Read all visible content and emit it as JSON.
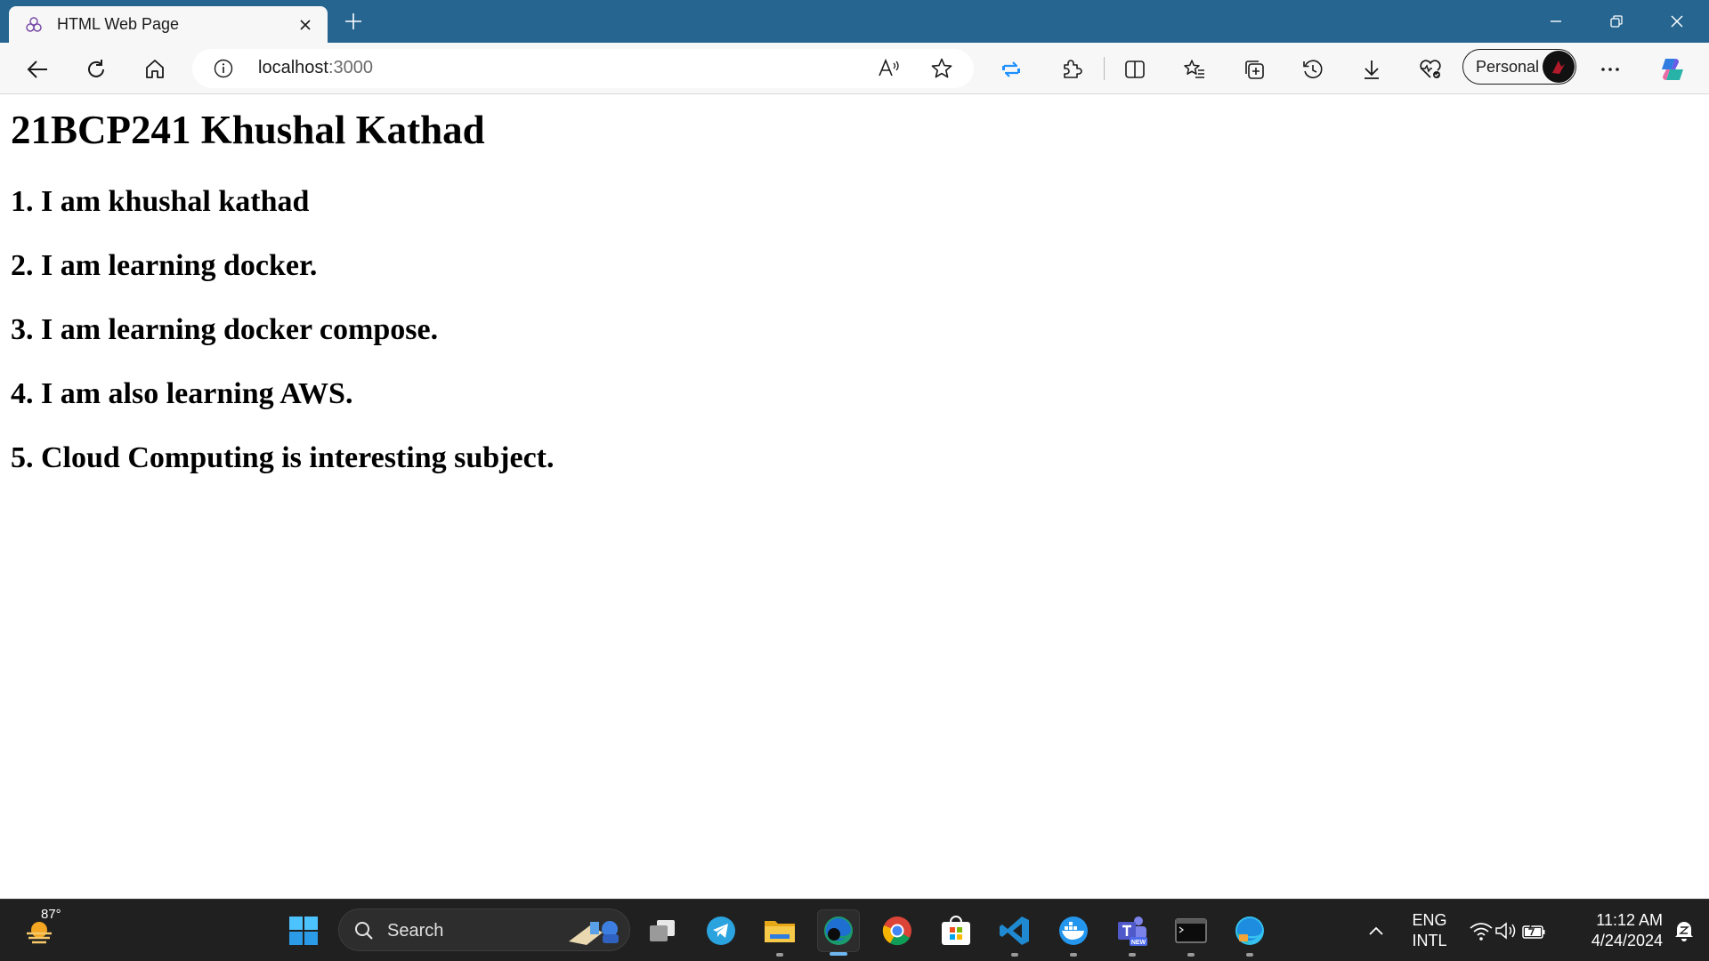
{
  "browser": {
    "tab_title": "HTML Web Page",
    "url_host": "localhost",
    "url_port": ":3000",
    "profile_name": "Personal"
  },
  "page": {
    "heading": "21BCP241 Khushal Kathad",
    "items": [
      "1. I am khushal kathad",
      "2. I am learning docker.",
      "3. I am learning docker compose.",
      "4. I am also learning AWS.",
      "5. Cloud Computing is interesting subject."
    ]
  },
  "taskbar": {
    "weather_temp": "87°",
    "search_label": "Search",
    "language_line1": "ENG",
    "language_line2": "INTL",
    "time": "11:12 AM",
    "date": "4/24/2024"
  },
  "colors": {
    "titlebar": "#256590",
    "toolbar": "#f7f7f7",
    "taskbar": "#202020",
    "accent": "#1e90ff"
  }
}
